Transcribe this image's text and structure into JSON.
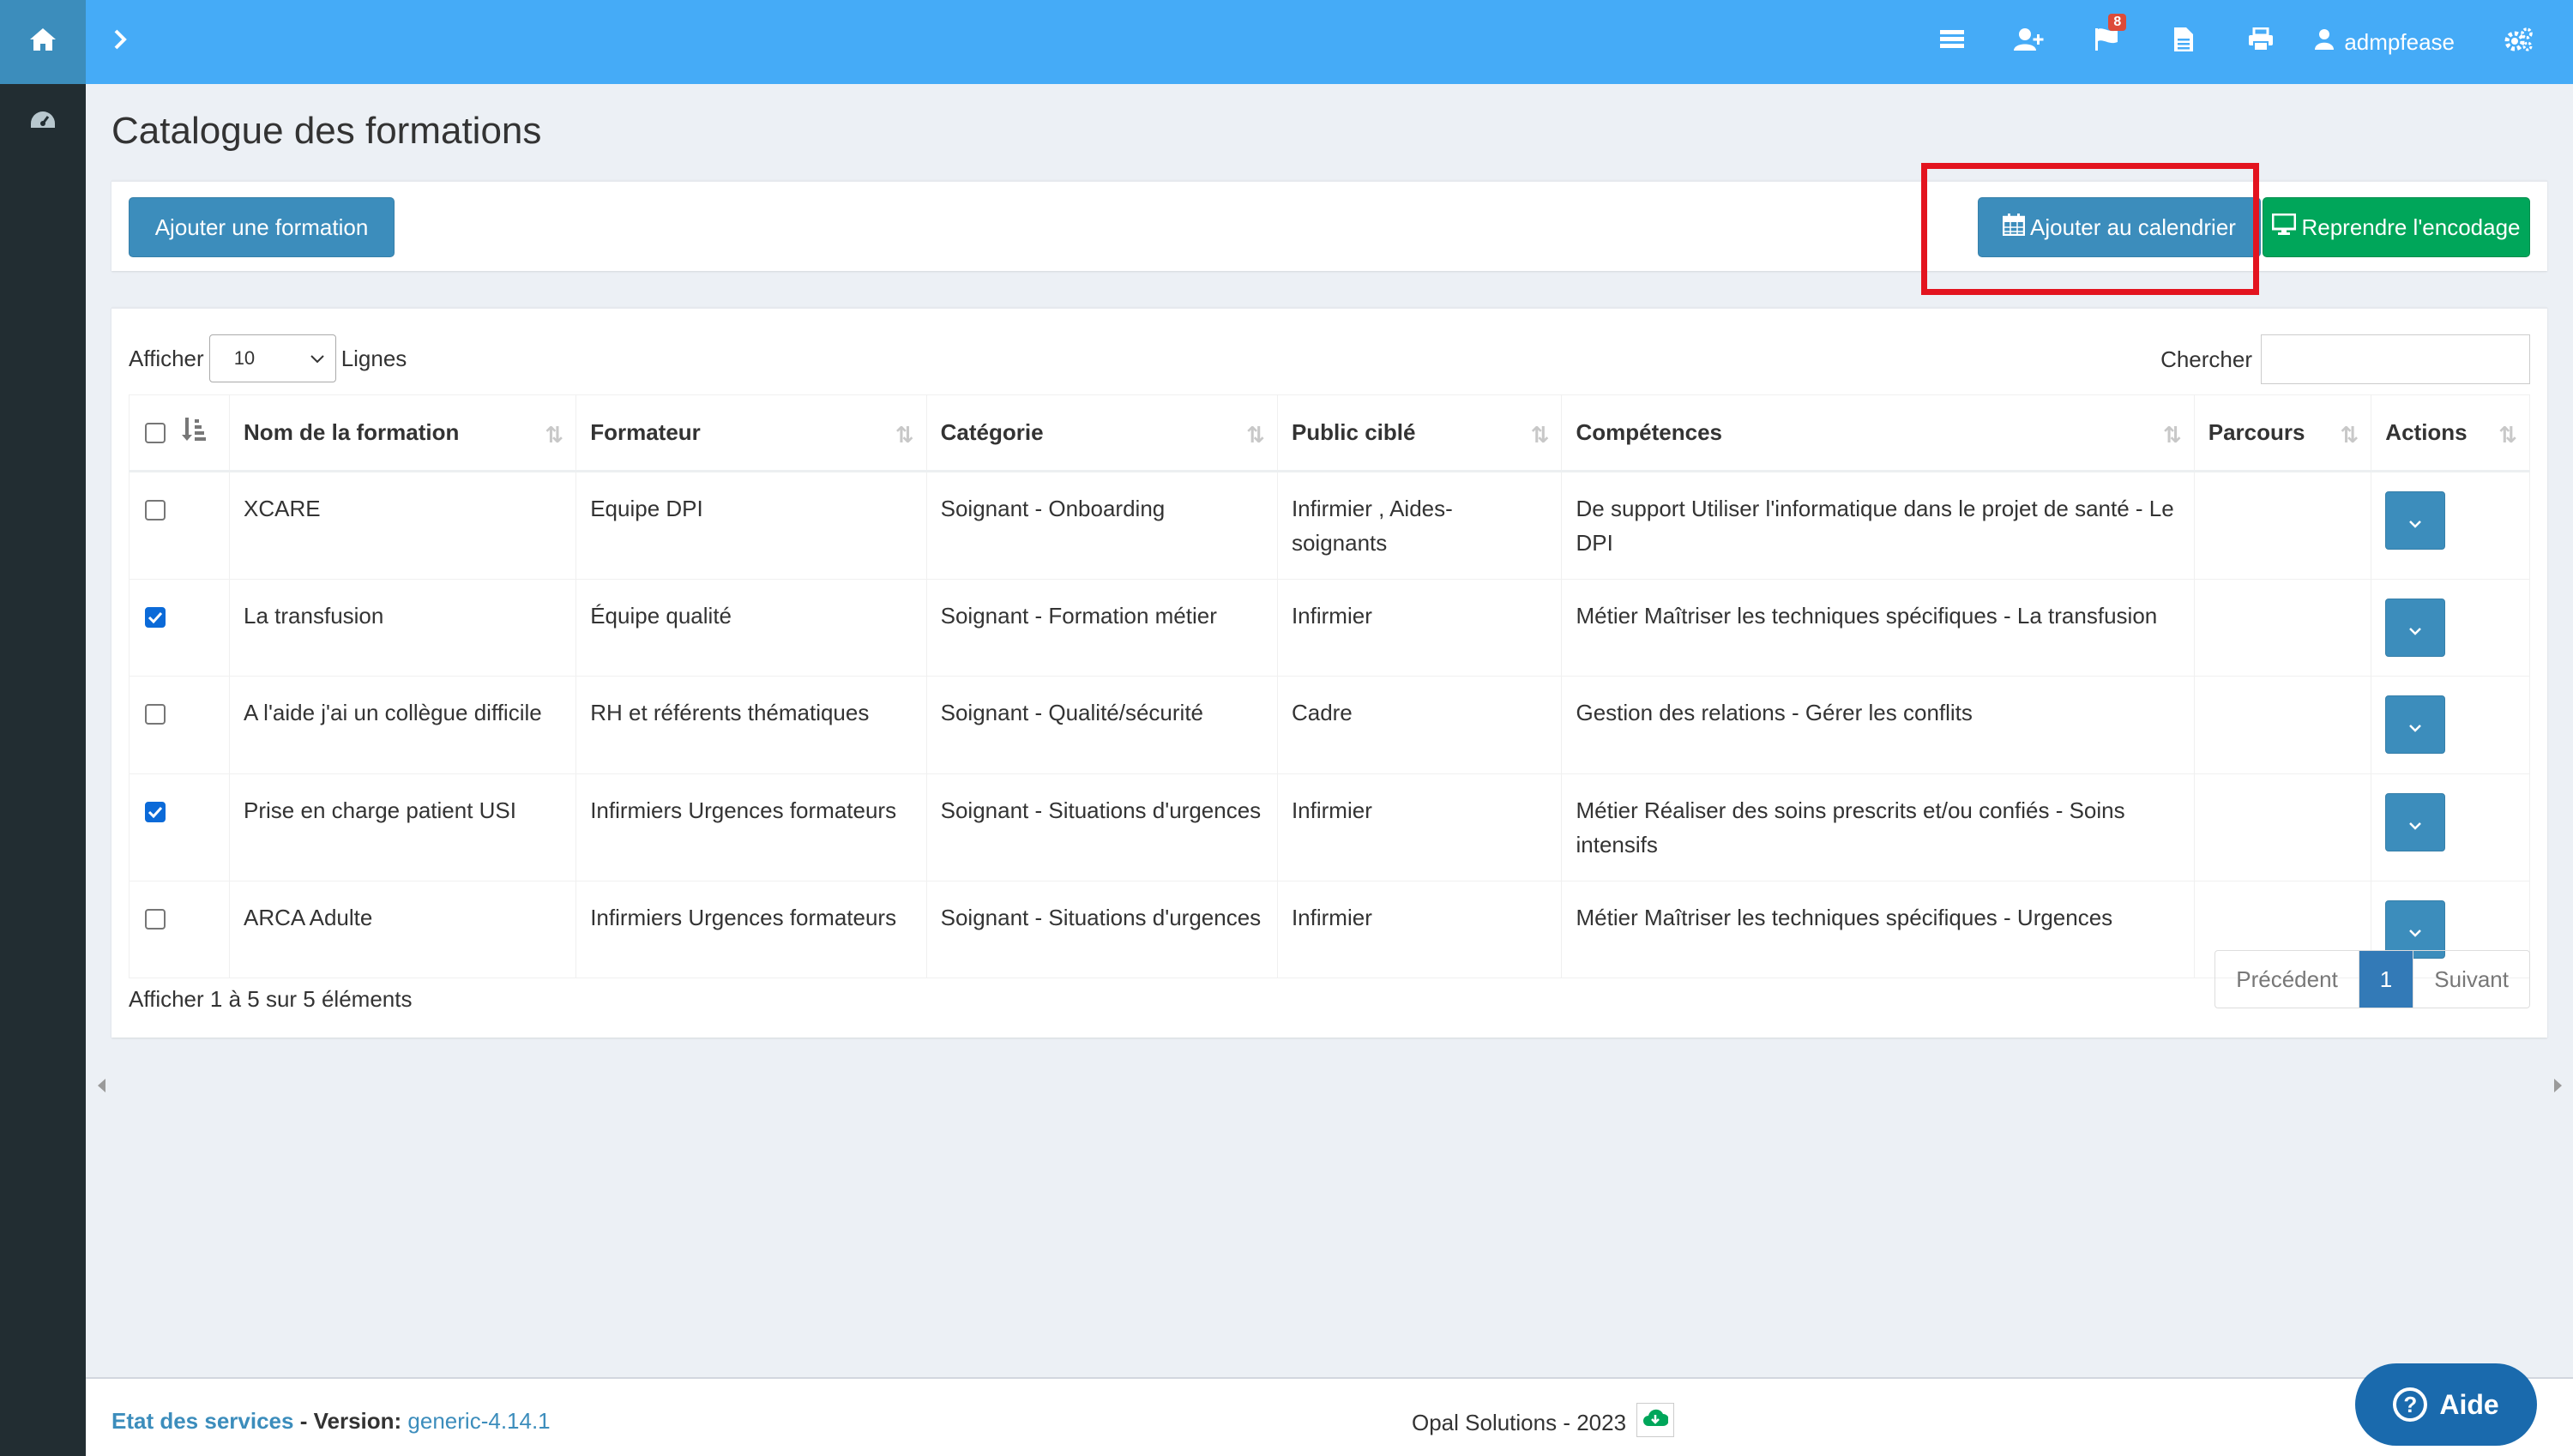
{
  "topbar": {
    "user": "admpfease",
    "flag_badge": "8"
  },
  "page": {
    "title": "Catalogue des formations"
  },
  "toolbar": {
    "add_formation": "Ajouter une formation",
    "add_calendar": "Ajouter au calendrier",
    "resume_encoding": "Reprendre l'encodage"
  },
  "table_controls": {
    "show_label": "Afficher",
    "page_size": "10",
    "rows_label": "Lignes",
    "search_label": "Chercher"
  },
  "columns": [
    "Nom de la formation",
    "Formateur",
    "Catégorie",
    "Public ciblé",
    "Compétences",
    "Parcours",
    "Actions"
  ],
  "rows": [
    {
      "checked": false,
      "name": "XCARE",
      "trainer": "Equipe DPI",
      "category": "Soignant - Onboarding",
      "public": "Infirmier , Aides-soignants",
      "skills": "De support Utiliser l'informatique dans le projet de santé - Le DPI",
      "path": ""
    },
    {
      "checked": true,
      "name": "La transfusion",
      "trainer": "Équipe qualité",
      "category": "Soignant - Formation métier",
      "public": "Infirmier",
      "skills": "Métier Maîtriser les techniques spécifiques - La transfusion",
      "path": ""
    },
    {
      "checked": false,
      "name": "A l'aide j'ai un collègue difficile",
      "trainer": "RH et référents thématiques",
      "category": "Soignant - Qualité/sécurité",
      "public": "Cadre",
      "skills": "Gestion des relations - Gérer les conflits",
      "path": ""
    },
    {
      "checked": true,
      "name": "Prise en charge patient USI",
      "trainer": "Infirmiers Urgences formateurs",
      "category": "Soignant - Situations d'urgences",
      "public": "Infirmier",
      "skills": "Métier Réaliser des soins prescrits et/ou confiés - Soins intensifs",
      "path": ""
    },
    {
      "checked": false,
      "name": "ARCA Adulte",
      "trainer": "Infirmiers Urgences formateurs",
      "category": "Soignant - Situations d'urgences",
      "public": "Infirmier",
      "skills": "Métier Maîtriser les techniques spécifiques - Urgences",
      "path": ""
    }
  ],
  "pagination": {
    "info": "Afficher 1 à 5 sur 5 éléments",
    "prev": "Précédent",
    "current": "1",
    "next": "Suivant"
  },
  "footer": {
    "services": "Etat des services",
    "version_label": "Version:",
    "version": "generic-4.14.1",
    "copyright": "Opal Solutions - 2023"
  },
  "help": {
    "label": "Aide"
  },
  "colors": {
    "topbar": "#45abf7",
    "sidebar": "#222d32",
    "primary": "#3c8dbc",
    "success": "#00a65a",
    "highlight": "#e3141f"
  }
}
